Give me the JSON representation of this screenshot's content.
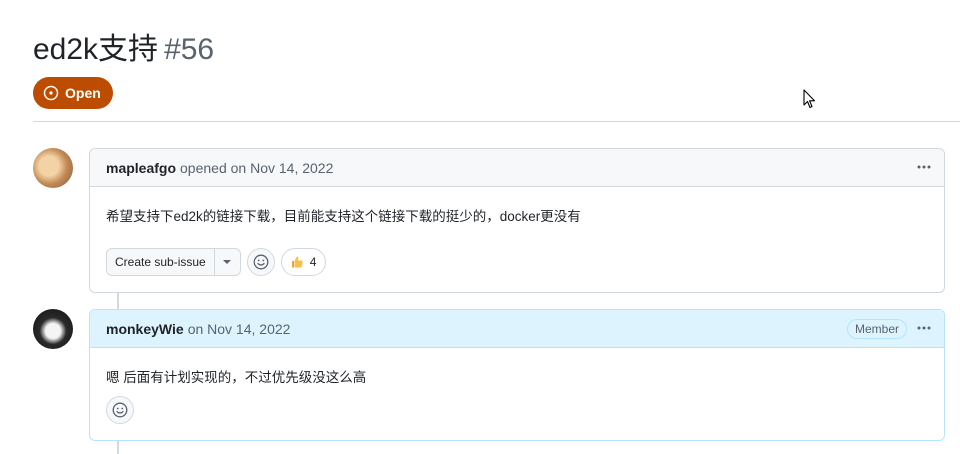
{
  "issue": {
    "title": "ed2k支持",
    "number": "#56",
    "state": "Open"
  },
  "comments": [
    {
      "author": "mapleafgo",
      "meta": "opened on Nov 14, 2022",
      "body": "希望支持下ed2k的链接下载，目前能支持这个链接下载的挺少的，docker更没有",
      "create_sub_issue_label": "Create sub-issue",
      "reaction_count": "4",
      "reaction_icon": "thumbs-up"
    },
    {
      "author": "monkeyWie",
      "meta": "on Nov 14, 2022",
      "role": "Member",
      "body": "嗯 后面有计划实现的，不过优先级没这么高"
    }
  ],
  "colors": {
    "open_badge": "#bc4c00",
    "member_header": "#ddf4ff"
  }
}
